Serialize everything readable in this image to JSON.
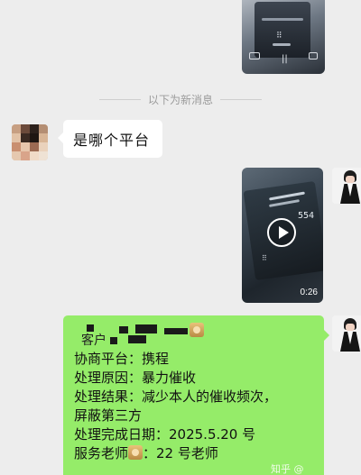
{
  "divider": {
    "label": "以下为新消息"
  },
  "messages": {
    "incoming_text": "是哪个平台",
    "video": {
      "duration": "0:26",
      "number_on_screen": "554"
    },
    "top_video": {
      "keypad_glyph": "⠿",
      "pause_glyph": "||"
    },
    "outgoing_card": {
      "line_customer": "客户",
      "line_platform": "协商平台：携程",
      "line_reason": "处理原因：暴力催收",
      "line_result": "处理结果：减少本人的催收频次，",
      "line_result_cont": "屏蔽第三方",
      "line_date": "处理完成日期：2025.5.20 号",
      "line_teacher_prefix": "服务老师",
      "line_teacher_suffix": "：22 号老师"
    }
  },
  "watermark": {
    "text": "知乎 @"
  },
  "colors": {
    "background": "#ededed",
    "incoming_bubble": "#ffffff",
    "outgoing_bubble": "#95ec69",
    "divider_text": "#9b9b9b"
  }
}
